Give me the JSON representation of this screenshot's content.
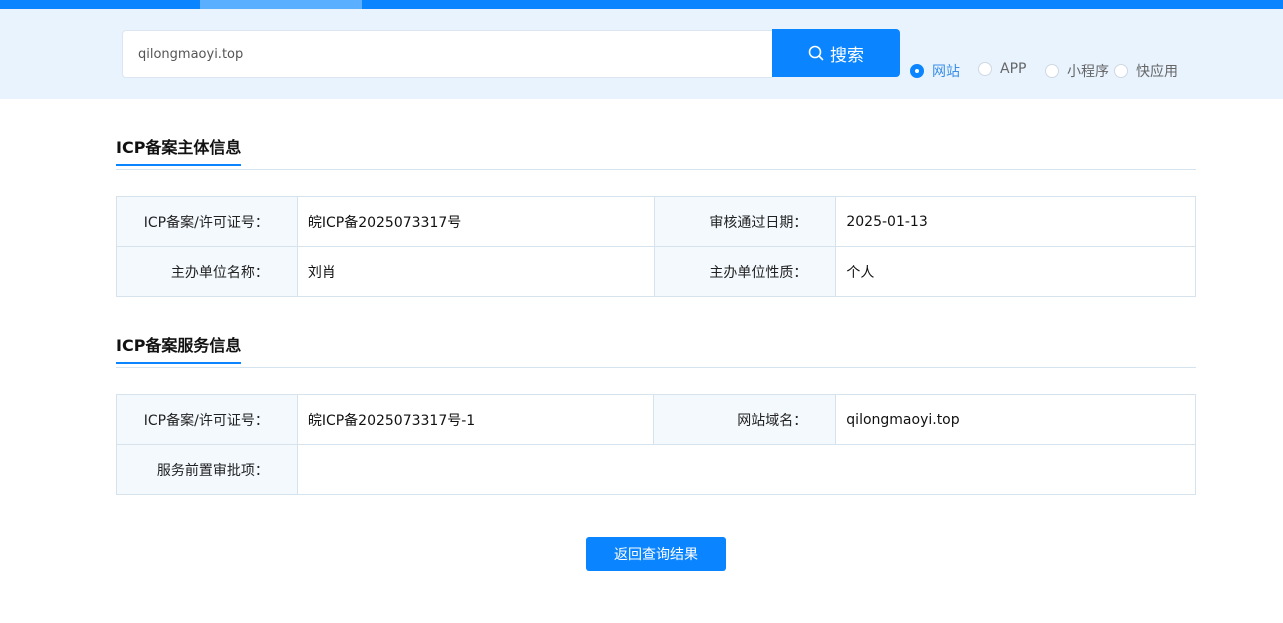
{
  "search": {
    "value": "qilongmaoyi.top",
    "button_label": "搜索"
  },
  "types": [
    {
      "label": "网站",
      "selected": true
    },
    {
      "label": "APP",
      "selected": false
    },
    {
      "label": "小程序",
      "selected": false
    },
    {
      "label": "快应用",
      "selected": false
    }
  ],
  "subject": {
    "title": "ICP备案主体信息",
    "rows": [
      {
        "label1": "ICP备案/许可证号：",
        "value1": "皖ICP备2025073317号",
        "label2": "审核通过日期：",
        "value2": "2025-01-13"
      },
      {
        "label1": "主办单位名称：",
        "value1": "刘肖",
        "label2": "主办单位性质：",
        "value2": "个人"
      }
    ]
  },
  "service": {
    "title": "ICP备案服务信息",
    "row1": {
      "label1": "ICP备案/许可证号：",
      "value1": "皖ICP备2025073317号-1",
      "label2": "网站域名：",
      "value2": "qilongmaoyi.top"
    },
    "row2": {
      "label": "服务前置审批项：",
      "value": ""
    }
  },
  "back_button_label": "返回查询结果"
}
